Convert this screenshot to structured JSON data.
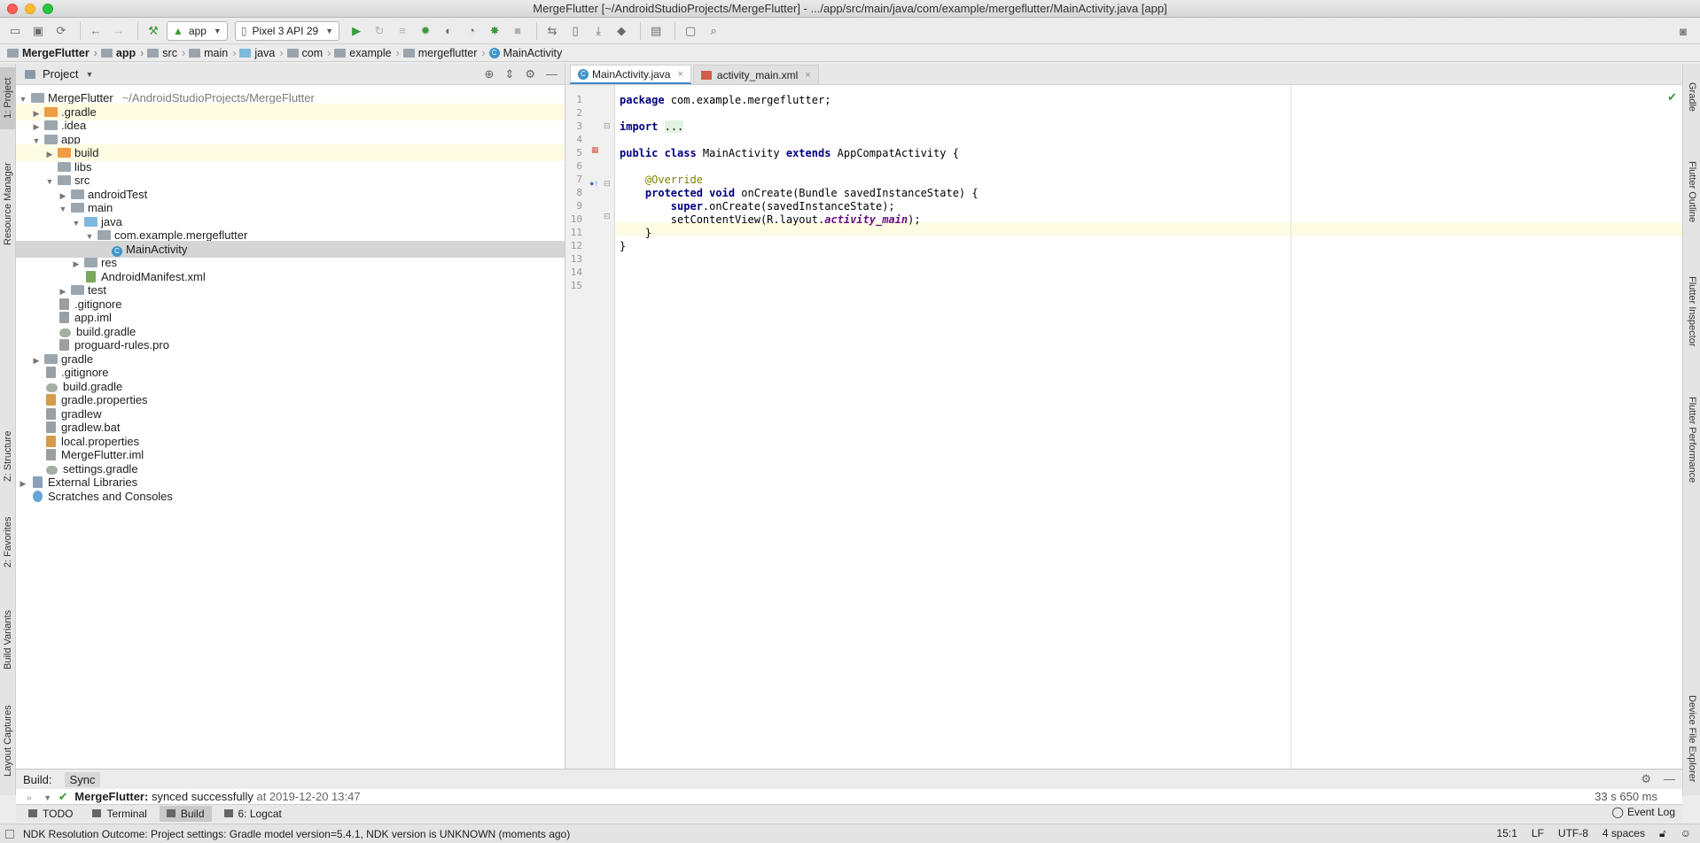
{
  "window": {
    "title": "MergeFlutter [~/AndroidStudioProjects/MergeFlutter] - .../app/src/main/java/com/example/mergeflutter/MainActivity.java [app]"
  },
  "toolbar": {
    "run_config": "app",
    "device": "Pixel 3 API 29"
  },
  "breadcrumb": [
    "MergeFlutter",
    "app",
    "src",
    "main",
    "java",
    "com",
    "example",
    "mergeflutter",
    "MainActivity"
  ],
  "left_tabs": [
    "1: Project",
    "Resource Manager",
    "Z: Structure",
    "2: Favorites",
    "Build Variants",
    "Layout Captures"
  ],
  "right_tabs": [
    "Gradle",
    "Flutter Outline",
    "Flutter Inspector",
    "Flutter Performance",
    "Device File Explorer"
  ],
  "project_panel": {
    "title": "Project",
    "tree": [
      {
        "label": "MergeFlutter",
        "hint": "~/AndroidStudioProjects/MergeFlutter",
        "depth": 0,
        "arrow": "open",
        "icon": "folder-gray"
      },
      {
        "label": ".gradle",
        "depth": 1,
        "arrow": "closed",
        "icon": "folder-orange",
        "hl": true
      },
      {
        "label": ".idea",
        "depth": 1,
        "arrow": "closed",
        "icon": "folder-gray"
      },
      {
        "label": "app",
        "depth": 1,
        "arrow": "open",
        "icon": "folder-gray"
      },
      {
        "label": "build",
        "depth": 2,
        "arrow": "closed",
        "icon": "folder-orange",
        "hl": true
      },
      {
        "label": "libs",
        "depth": 2,
        "arrow": "none",
        "icon": "folder-gray"
      },
      {
        "label": "src",
        "depth": 2,
        "arrow": "open",
        "icon": "folder-gray"
      },
      {
        "label": "androidTest",
        "depth": 3,
        "arrow": "closed",
        "icon": "folder-gray"
      },
      {
        "label": "main",
        "depth": 3,
        "arrow": "open",
        "icon": "folder-gray"
      },
      {
        "label": "java",
        "depth": 4,
        "arrow": "open",
        "icon": "folder-blue"
      },
      {
        "label": "com.example.mergeflutter",
        "depth": 5,
        "arrow": "open",
        "icon": "folder-gray"
      },
      {
        "label": "MainActivity",
        "depth": 6,
        "arrow": "none",
        "icon": "class",
        "sel": true
      },
      {
        "label": "res",
        "depth": 4,
        "arrow": "closed",
        "icon": "folder-gray"
      },
      {
        "label": "AndroidManifest.xml",
        "depth": 4,
        "arrow": "none",
        "icon": "file-xml"
      },
      {
        "label": "test",
        "depth": 3,
        "arrow": "closed",
        "icon": "folder-gray"
      },
      {
        "label": ".gitignore",
        "depth": 2,
        "arrow": "none",
        "icon": "file"
      },
      {
        "label": "app.iml",
        "depth": 2,
        "arrow": "none",
        "icon": "file"
      },
      {
        "label": "build.gradle",
        "depth": 2,
        "arrow": "none",
        "icon": "file-gradle"
      },
      {
        "label": "proguard-rules.pro",
        "depth": 2,
        "arrow": "none",
        "icon": "file"
      },
      {
        "label": "gradle",
        "depth": 1,
        "arrow": "closed",
        "icon": "folder-gray"
      },
      {
        "label": ".gitignore",
        "depth": 1,
        "arrow": "none",
        "icon": "file"
      },
      {
        "label": "build.gradle",
        "depth": 1,
        "arrow": "none",
        "icon": "file-gradle"
      },
      {
        "label": "gradle.properties",
        "depth": 1,
        "arrow": "none",
        "icon": "file-props"
      },
      {
        "label": "gradlew",
        "depth": 1,
        "arrow": "none",
        "icon": "file"
      },
      {
        "label": "gradlew.bat",
        "depth": 1,
        "arrow": "none",
        "icon": "file"
      },
      {
        "label": "local.properties",
        "depth": 1,
        "arrow": "none",
        "icon": "file-props"
      },
      {
        "label": "MergeFlutter.iml",
        "depth": 1,
        "arrow": "none",
        "icon": "file"
      },
      {
        "label": "settings.gradle",
        "depth": 1,
        "arrow": "none",
        "icon": "file-gradle"
      },
      {
        "label": "External Libraries",
        "depth": 0,
        "arrow": "closed",
        "icon": "file-lib"
      },
      {
        "label": "Scratches and Consoles",
        "depth": 0,
        "arrow": "none",
        "icon": "file-scratch"
      }
    ]
  },
  "editor": {
    "tabs": [
      {
        "label": "MainActivity.java",
        "active": true
      },
      {
        "label": "activity_main.xml",
        "active": false
      }
    ],
    "line_numbers": [
      "1",
      "2",
      "3",
      "4",
      "5",
      "6",
      "7",
      "8",
      "9",
      "10",
      "11",
      "12",
      "13",
      "14",
      "15"
    ]
  },
  "build_panel": {
    "label": "Build:",
    "tab": "Sync",
    "project": "MergeFlutter:",
    "message": "synced successfully",
    "at": "at 2019-12-20 13:47",
    "duration": "33 s 650 ms"
  },
  "bottom_tabs": [
    {
      "label": "TODO",
      "active": false
    },
    {
      "label": "Terminal",
      "active": false
    },
    {
      "label": "Build",
      "active": true
    },
    {
      "label": "6: Logcat",
      "active": false
    }
  ],
  "event_log": "Event Log",
  "status": {
    "message": "NDK Resolution Outcome: Project settings: Gradle model version=5.4.1, NDK version is UNKNOWN (moments ago)",
    "position": "15:1",
    "line_sep": "LF",
    "encoding": "UTF-8",
    "indent": "4 spaces"
  }
}
